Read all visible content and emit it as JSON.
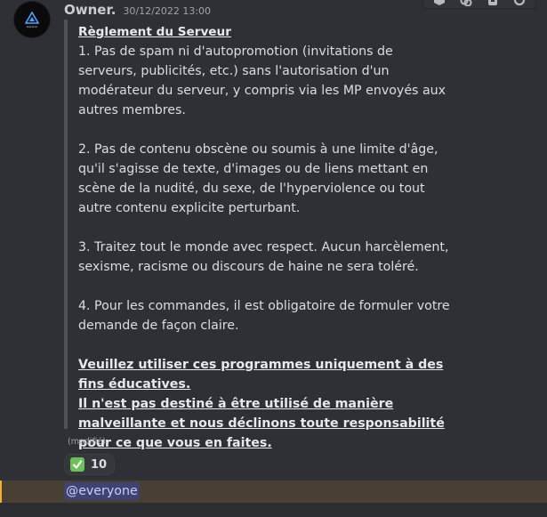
{
  "message": {
    "author": "Owner.",
    "timestamp": "30/12/2022 13:00",
    "avatar_icon": "server-logo-icon",
    "edited_label": "(modifié)",
    "title": "Règlement du Serveur",
    "rules": [
      "1. Pas de spam ni d'autopromotion (invitations de serveurs, publicités, etc.) sans l'autorisation d'un modérateur du serveur, y compris via les MP envoyés aux autres membres.",
      "2. Pas de contenu obscène ou soumis à une limite d'âge, qu'il s'agisse de texte, d'images ou de liens mettant en scène de la nudité, du sexe, de l'hyperviolence ou tout autre contenu explicite perturbant.",
      "3. Traitez tout le monde avec respect. Aucun harcèlement, sexisme, racisme ou discours de haine ne sera toléré.",
      "4. Pour les commandes, il est obligatoire de formuler votre demande de façon claire."
    ],
    "disclaimer": [
      "Veuillez utiliser ces programmes uniquement à des fins éducatives.",
      "Il n'est pas destiné à être utilisé de manière malveillante et nous déclinons toute responsabilité pour ce que vous en faites."
    ]
  },
  "reaction": {
    "emoji": "check-mark-icon",
    "count": "10"
  },
  "mention": {
    "text": "@everyone"
  },
  "toolbar": {
    "icons": [
      "reaction-icon",
      "link-icon",
      "bookmark-icon",
      "more-icon"
    ]
  },
  "colors": {
    "background": "#313338",
    "mention_highlight": "#494033",
    "mention_bar": "#f0b232",
    "mention_pill": "#3e4371",
    "check_green": "#6ac259"
  }
}
